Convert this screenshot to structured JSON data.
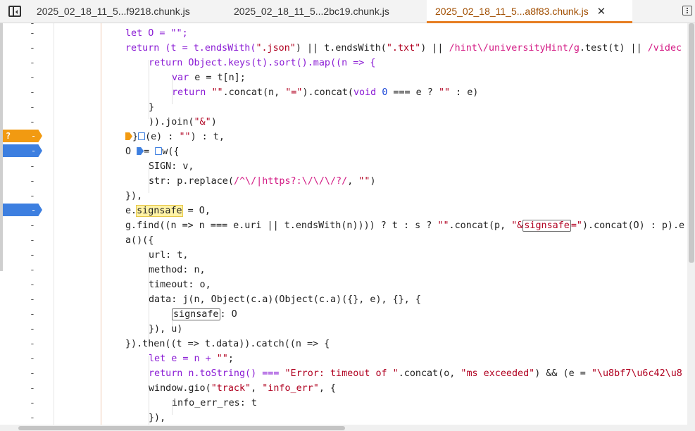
{
  "tabs": [
    {
      "label": "2025_02_18_11_5...f9218.chunk.js",
      "active": false
    },
    {
      "label": "2025_02_18_11_5...2bc19.chunk.js",
      "active": false
    },
    {
      "label": "2025_02_18_11_5...a8f83.chunk.js",
      "active": true
    }
  ],
  "close_glyph": "✕",
  "gutter": {
    "dash": "-",
    "question": "?"
  },
  "code": {
    "l1": "let O = \"\";",
    "l2a": "return (t = t.endsWith(",
    "l2b": "\".json\"",
    "l2c": ") || t.endsWith(",
    "l2d": "\".txt\"",
    "l2e": ") || ",
    "l2f": "/hint\\/universityHint/g",
    "l2g": ".test(t) || ",
    "l2h": "/videc",
    "l3": "return Object.keys(t).sort().map((n => {",
    "l4a": "var",
    "l4b": " e = t[n];",
    "l5a": "return ",
    "l5b": "\"\"",
    "l5c": ".concat(n, ",
    "l5d": "\"=\"",
    "l5e": ").concat(",
    "l5f": "void",
    "l5g": " ",
    "l5h": "0",
    "l5i": " === e ? ",
    "l5j": "\"\"",
    "l5k": " : e)",
    "l6": "}",
    "l7a": ")).join(",
    "l7b": "\"&\"",
    "l7c": ")",
    "l8a": "}",
    "l8b": "(e) : ",
    "l8c": "\"\"",
    "l8d": ") : t,",
    "l9a": "O ",
    "l9b": "= ",
    "l9c": "w({",
    "l10": "SIGN: v,",
    "l11a": "str: p.replace(",
    "l11b": "/^\\/|https?:\\/\\/\\/?/",
    "l11c": ", ",
    "l11d": "\"\"",
    "l11e": ")",
    "l12": "}),",
    "l13a": "e.",
    "l13b": "signsafe",
    "l13c": " = O,",
    "l14a": "g.find((n => n === e.uri || t.endsWith(n)))) ? t : s ? ",
    "l14b": "\"\"",
    "l14c": ".concat(p, ",
    "l14d": "\"&",
    "l14e": "signsafe",
    "l14f": "=\"",
    "l14g": ").concat(O) : p).e",
    "l15": "a()({",
    "l16": "url: t,",
    "l17": "method: n,",
    "l18": "timeout: o,",
    "l19a": "data: j(n, Object(c.a)(Object(c.a)({}, e), {}, {",
    "l20a": "signsafe",
    "l20b": ": O",
    "l21": "}), u)",
    "l22": "}).then((t => t.data)).catch((n => {",
    "l23a": "let e = n + ",
    "l23b": "\"\"",
    "l23c": ";",
    "l24a": "return n.toString() === ",
    "l24b": "\"Error: timeout of \"",
    "l24c": ".concat(o, ",
    "l24d": "\"ms exceeded\"",
    "l24e": ") && (e = ",
    "l24f": "\"\\u8bf7\\u6c42\\u8",
    "l25a": "window.gio(",
    "l25b": "\"track\"",
    "l25c": ", ",
    "l25d": "\"info_err\"",
    "l25e": ", {",
    "l26": "info_err_res: t",
    "l27": "}),"
  },
  "colors": {
    "breakpoint_orange": "#f29a11",
    "breakpoint_blue": "#3d7fe0",
    "active_tab_text": "#a14e00",
    "keyword": "#8a1bd4",
    "string": "#b00020",
    "number": "#1a46d8",
    "regex": "#d31a84"
  }
}
